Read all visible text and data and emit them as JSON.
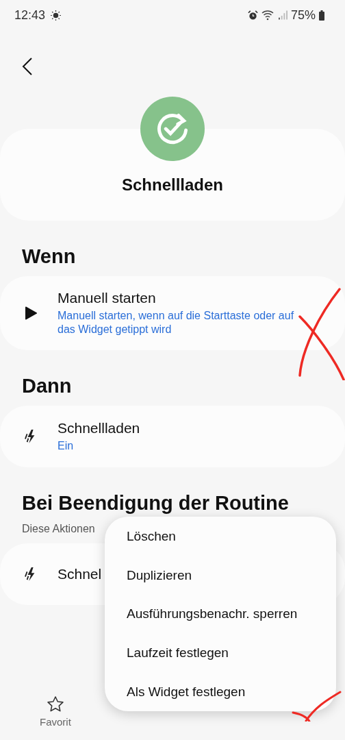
{
  "status_bar": {
    "time": "12:43",
    "battery": "75%"
  },
  "routine": {
    "title": "Schnellladen"
  },
  "sections": [
    {
      "heading": "Wenn",
      "items": [
        {
          "kind": "play",
          "title": "Manuell starten",
          "subtitle": "Manuell starten, wenn auf die Starttaste oder auf das Widget getippt wird"
        }
      ]
    },
    {
      "heading": "Dann",
      "items": [
        {
          "kind": "bolt",
          "title": "Schnellladen",
          "subtitle": "Ein"
        }
      ]
    },
    {
      "heading": "Bei Beendigung der Routine",
      "description": "Diese Aktionen",
      "items": [
        {
          "kind": "bolt",
          "title": "Schnel"
        }
      ]
    }
  ],
  "bottom_nav": [
    {
      "label": "Favorit"
    }
  ],
  "menu": [
    {
      "label": "Löschen"
    },
    {
      "label": "Duplizieren"
    },
    {
      "label": "Ausführungsbenachr. sperren"
    },
    {
      "label": "Laufzeit festlegen"
    },
    {
      "label": "Als Widget festlegen"
    }
  ]
}
